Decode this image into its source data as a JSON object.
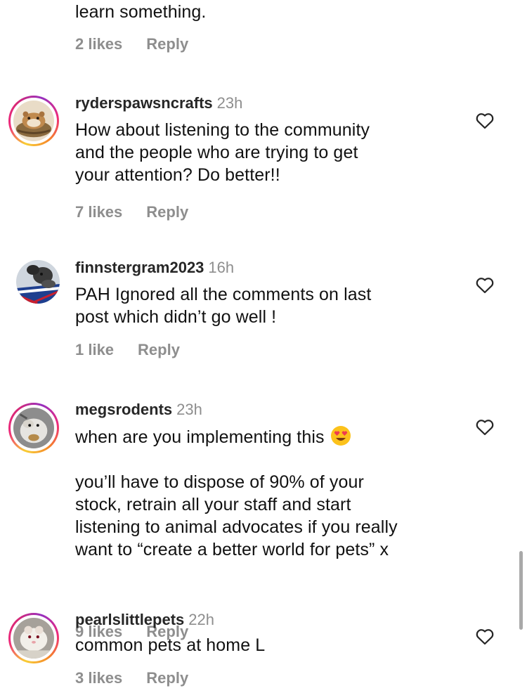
{
  "top_fragment": {
    "text": "learn something.",
    "likes": "2 likes",
    "reply": "Reply"
  },
  "comments": [
    {
      "username": "ryderspawsncrafts",
      "time": "23h",
      "text": "How about listening to the community\nand the people who are trying to get\nyour attention? Do better!!",
      "likes": "7 likes",
      "reply": "Reply"
    },
    {
      "username": "finnstergram2023",
      "time": "16h",
      "text": "PAH Ignored all the comments on last\npost which didn’t go well !",
      "likes": "1 like",
      "reply": "Reply"
    },
    {
      "username": "megsrodents",
      "time": "23h",
      "text_line1": "when are you implementing this",
      "text_rest": "you’ll have to dispose of 90% of your\nstock, retrain all your staff and start\nlistening to animal advocates if you really\nwant to “create a better world for pets” x",
      "likes": "9 likes",
      "reply": "Reply"
    },
    {
      "username": "pearlslittlepets",
      "time": "22h",
      "text": "common pets at home L",
      "likes": "3 likes",
      "reply": "Reply"
    }
  ],
  "icons": {
    "like": "heart-outline-icon",
    "emoji": "heart-eyes-emoji"
  },
  "colors": {
    "muted": "#8e8e8e",
    "text": "#111111",
    "username": "#262626"
  }
}
